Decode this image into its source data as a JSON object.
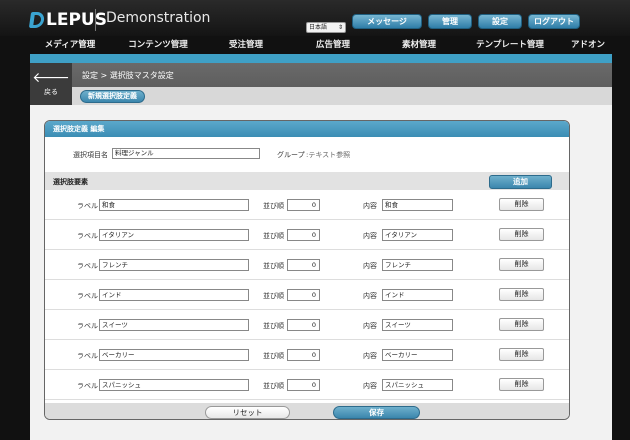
{
  "header": {
    "logo_text": "LEPUS",
    "app_title": "Demonstration",
    "lang_select": "日本語",
    "buttons": {
      "message": "メッセージ",
      "admin": "管理",
      "settings": "設定",
      "logout": "ログアウト"
    }
  },
  "nav": {
    "items": [
      "メディア管理",
      "コンテンツ管理",
      "受注管理",
      "広告管理",
      "素材管理",
      "テンプレート管理",
      "アドオン"
    ]
  },
  "subheader": {
    "back_label": "戻る",
    "breadcrumb": "設定 > 選択肢マスタ設定",
    "new_button": "新規選択肢定義"
  },
  "panel": {
    "title": "選択肢定義 編集",
    "item_name_label": "選択項目名",
    "item_name_value": "料理ジャンル",
    "group_label": "グループ",
    "group_value": ":テキスト参照",
    "elements_label": "選択肢要素",
    "add_button": "追加",
    "field_labels": {
      "label": "ラベル",
      "order": "並び順",
      "content": "内容",
      "delete": "削除"
    },
    "rows": [
      {
        "label": "和食",
        "order": "0",
        "content": "和食"
      },
      {
        "label": "イタリアン",
        "order": "0",
        "content": "イタリアン"
      },
      {
        "label": "フレンチ",
        "order": "0",
        "content": "フレンチ"
      },
      {
        "label": "インド",
        "order": "0",
        "content": "インド"
      },
      {
        "label": "スイーツ",
        "order": "0",
        "content": "スイーツ"
      },
      {
        "label": "ベーカリー",
        "order": "0",
        "content": "ベーカリー"
      },
      {
        "label": "スパニッシュ",
        "order": "0",
        "content": "スパニッシュ"
      }
    ],
    "reset_button": "リセット",
    "save_button": "保存"
  },
  "colors": {
    "accent": "#3fa0c6",
    "header_bg": "#1c1c1c",
    "button_blue": "#3b86ad"
  }
}
